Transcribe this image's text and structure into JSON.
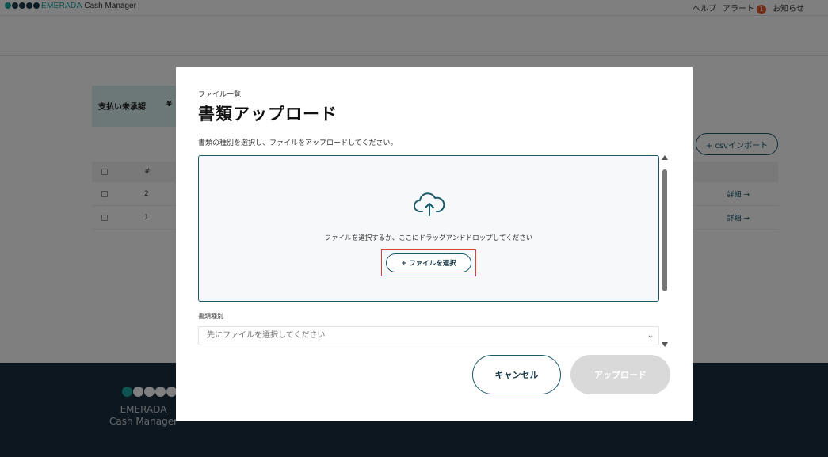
{
  "header": {
    "brand_accent": "EMERADA",
    "brand_rest": " Cash Manager",
    "help": "ヘルプ",
    "alert": "アラート",
    "alert_count": "1",
    "notice": "お知らせ"
  },
  "summary": {
    "label": "支払い未承認",
    "currency": "¥"
  },
  "csv_import": "+ csvインポート",
  "table": {
    "header_num": "#",
    "rows": [
      {
        "num": "2",
        "detail": "詳細 →"
      },
      {
        "num": "1",
        "detail": "詳細 →"
      }
    ]
  },
  "footer": {
    "line1": "EMERADA",
    "line2": "Cash Manager"
  },
  "modal": {
    "breadcrumb": "ファイル一覧",
    "title": "書類アップロード",
    "description": "書類の種別を選択し、ファイルをアップロードしてください。",
    "drop_text": "ファイルを選択するか、ここにドラッグアンドドロップしてください",
    "select_file": "+ ファイルを選択",
    "doc_type_label": "書類種別",
    "doc_type_placeholder": "先にファイルを選択してください",
    "cancel": "キャンセル",
    "upload": "アップロード"
  },
  "colors": {
    "accent": "#1aa7a0",
    "primary_dark": "#1a5a6a",
    "highlight": "#e0403a",
    "footer_bg": "#1b2f3e",
    "disabled": "#d9d9d9"
  },
  "icons": [
    "cloud-upload-icon",
    "chevron-down-icon",
    "scroll-up-arrow-icon",
    "scroll-down-arrow-icon",
    "logo-icon"
  ]
}
